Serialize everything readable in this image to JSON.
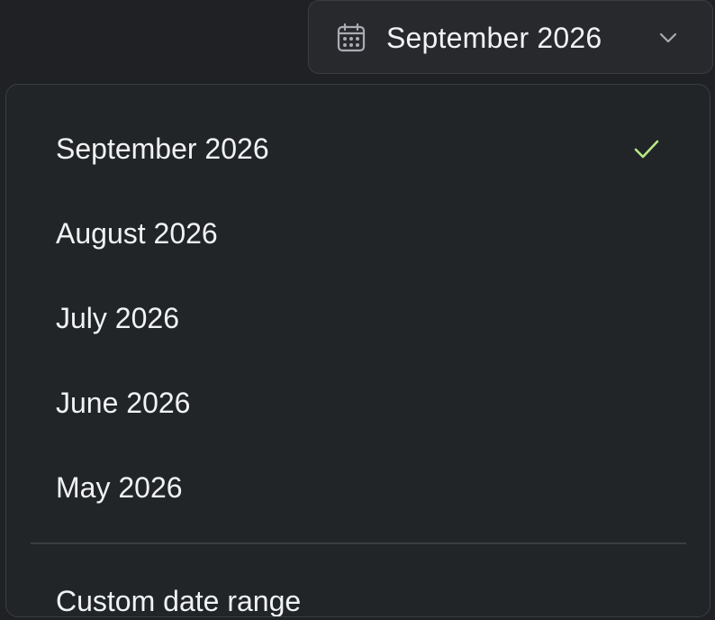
{
  "trigger": {
    "icon": "calendar-icon",
    "label": "September 2026",
    "chevron_icon": "chevron-down-icon"
  },
  "menu": {
    "items": [
      {
        "label": "September 2026",
        "selected": true
      },
      {
        "label": "August 2026",
        "selected": false
      },
      {
        "label": "July 2026",
        "selected": false
      },
      {
        "label": "June 2026",
        "selected": false
      },
      {
        "label": "May 2026",
        "selected": false
      }
    ],
    "selected_icon": "check-icon",
    "custom_label": "Custom date range"
  },
  "colors": {
    "background": "#1f2124",
    "menu_bg": "#222528",
    "border": "#3a3d42",
    "text": "#f1f2f4",
    "check": "#b8e986"
  }
}
